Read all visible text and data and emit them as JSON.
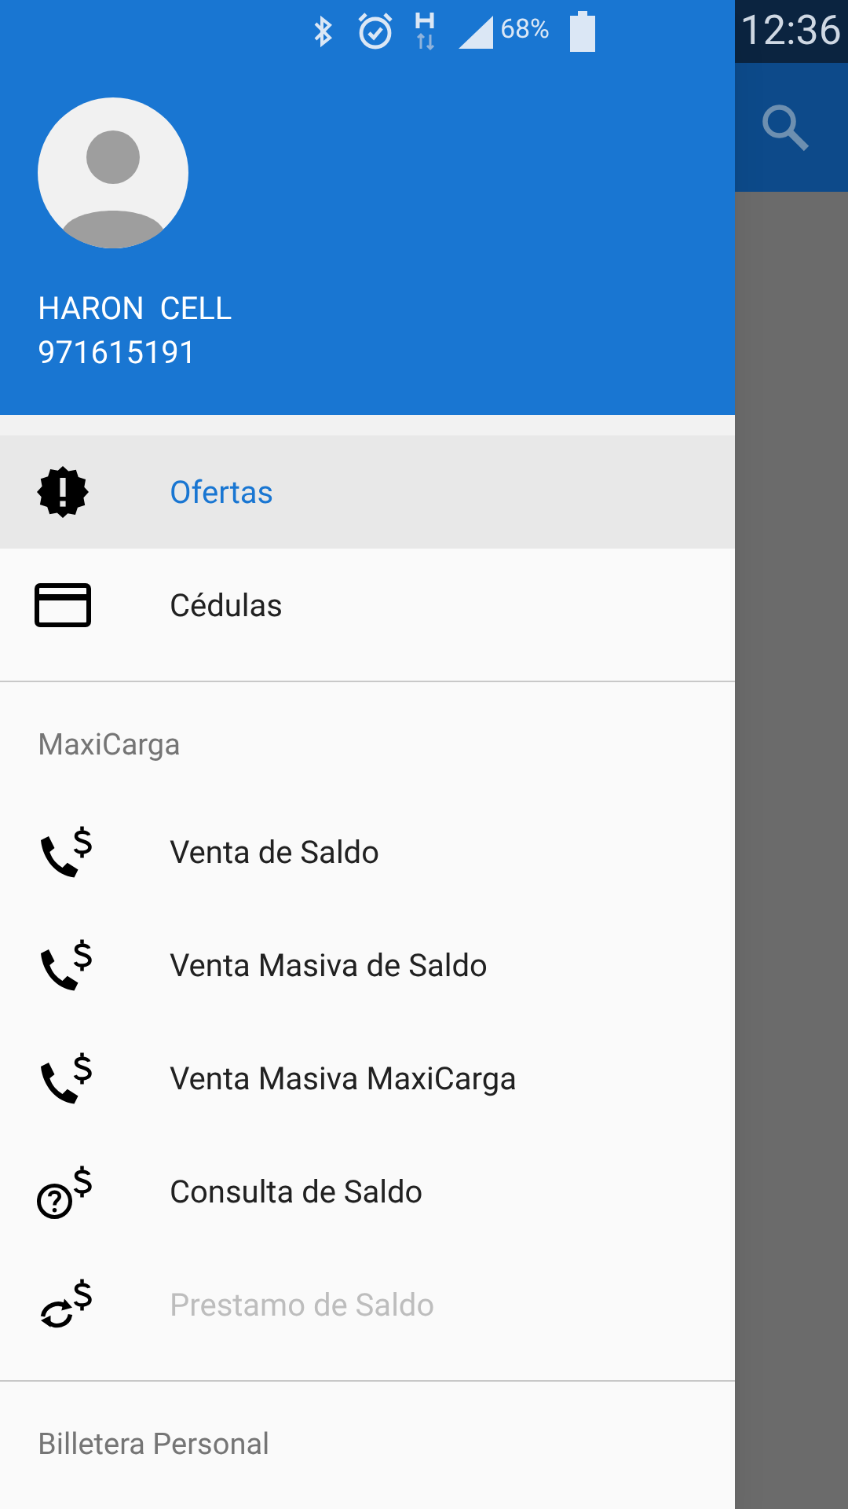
{
  "status_bar": {
    "battery": "68%",
    "time": "12:36"
  },
  "user": {
    "name": "HARON  CELL",
    "phone": "971615191"
  },
  "sections": [
    {
      "items": [
        {
          "kind": "badge",
          "label": "Ofertas",
          "selected": true,
          "disabled": false
        },
        {
          "kind": "card",
          "label": "Cédulas",
          "selected": false,
          "disabled": false
        }
      ]
    },
    {
      "title": "MaxiCarga",
      "items": [
        {
          "kind": "phone",
          "label": "Venta de Saldo",
          "selected": false,
          "disabled": false
        },
        {
          "kind": "phone",
          "label": "Venta Masiva de Saldo",
          "selected": false,
          "disabled": false
        },
        {
          "kind": "phone",
          "label": "Venta Masiva MaxiCarga",
          "selected": false,
          "disabled": false
        },
        {
          "kind": "query",
          "label": "Consulta de Saldo",
          "selected": false,
          "disabled": false
        },
        {
          "kind": "loan",
          "label": "Prestamo de Saldo",
          "selected": false,
          "disabled": true
        }
      ]
    },
    {
      "title": "Billetera Personal"
    }
  ]
}
